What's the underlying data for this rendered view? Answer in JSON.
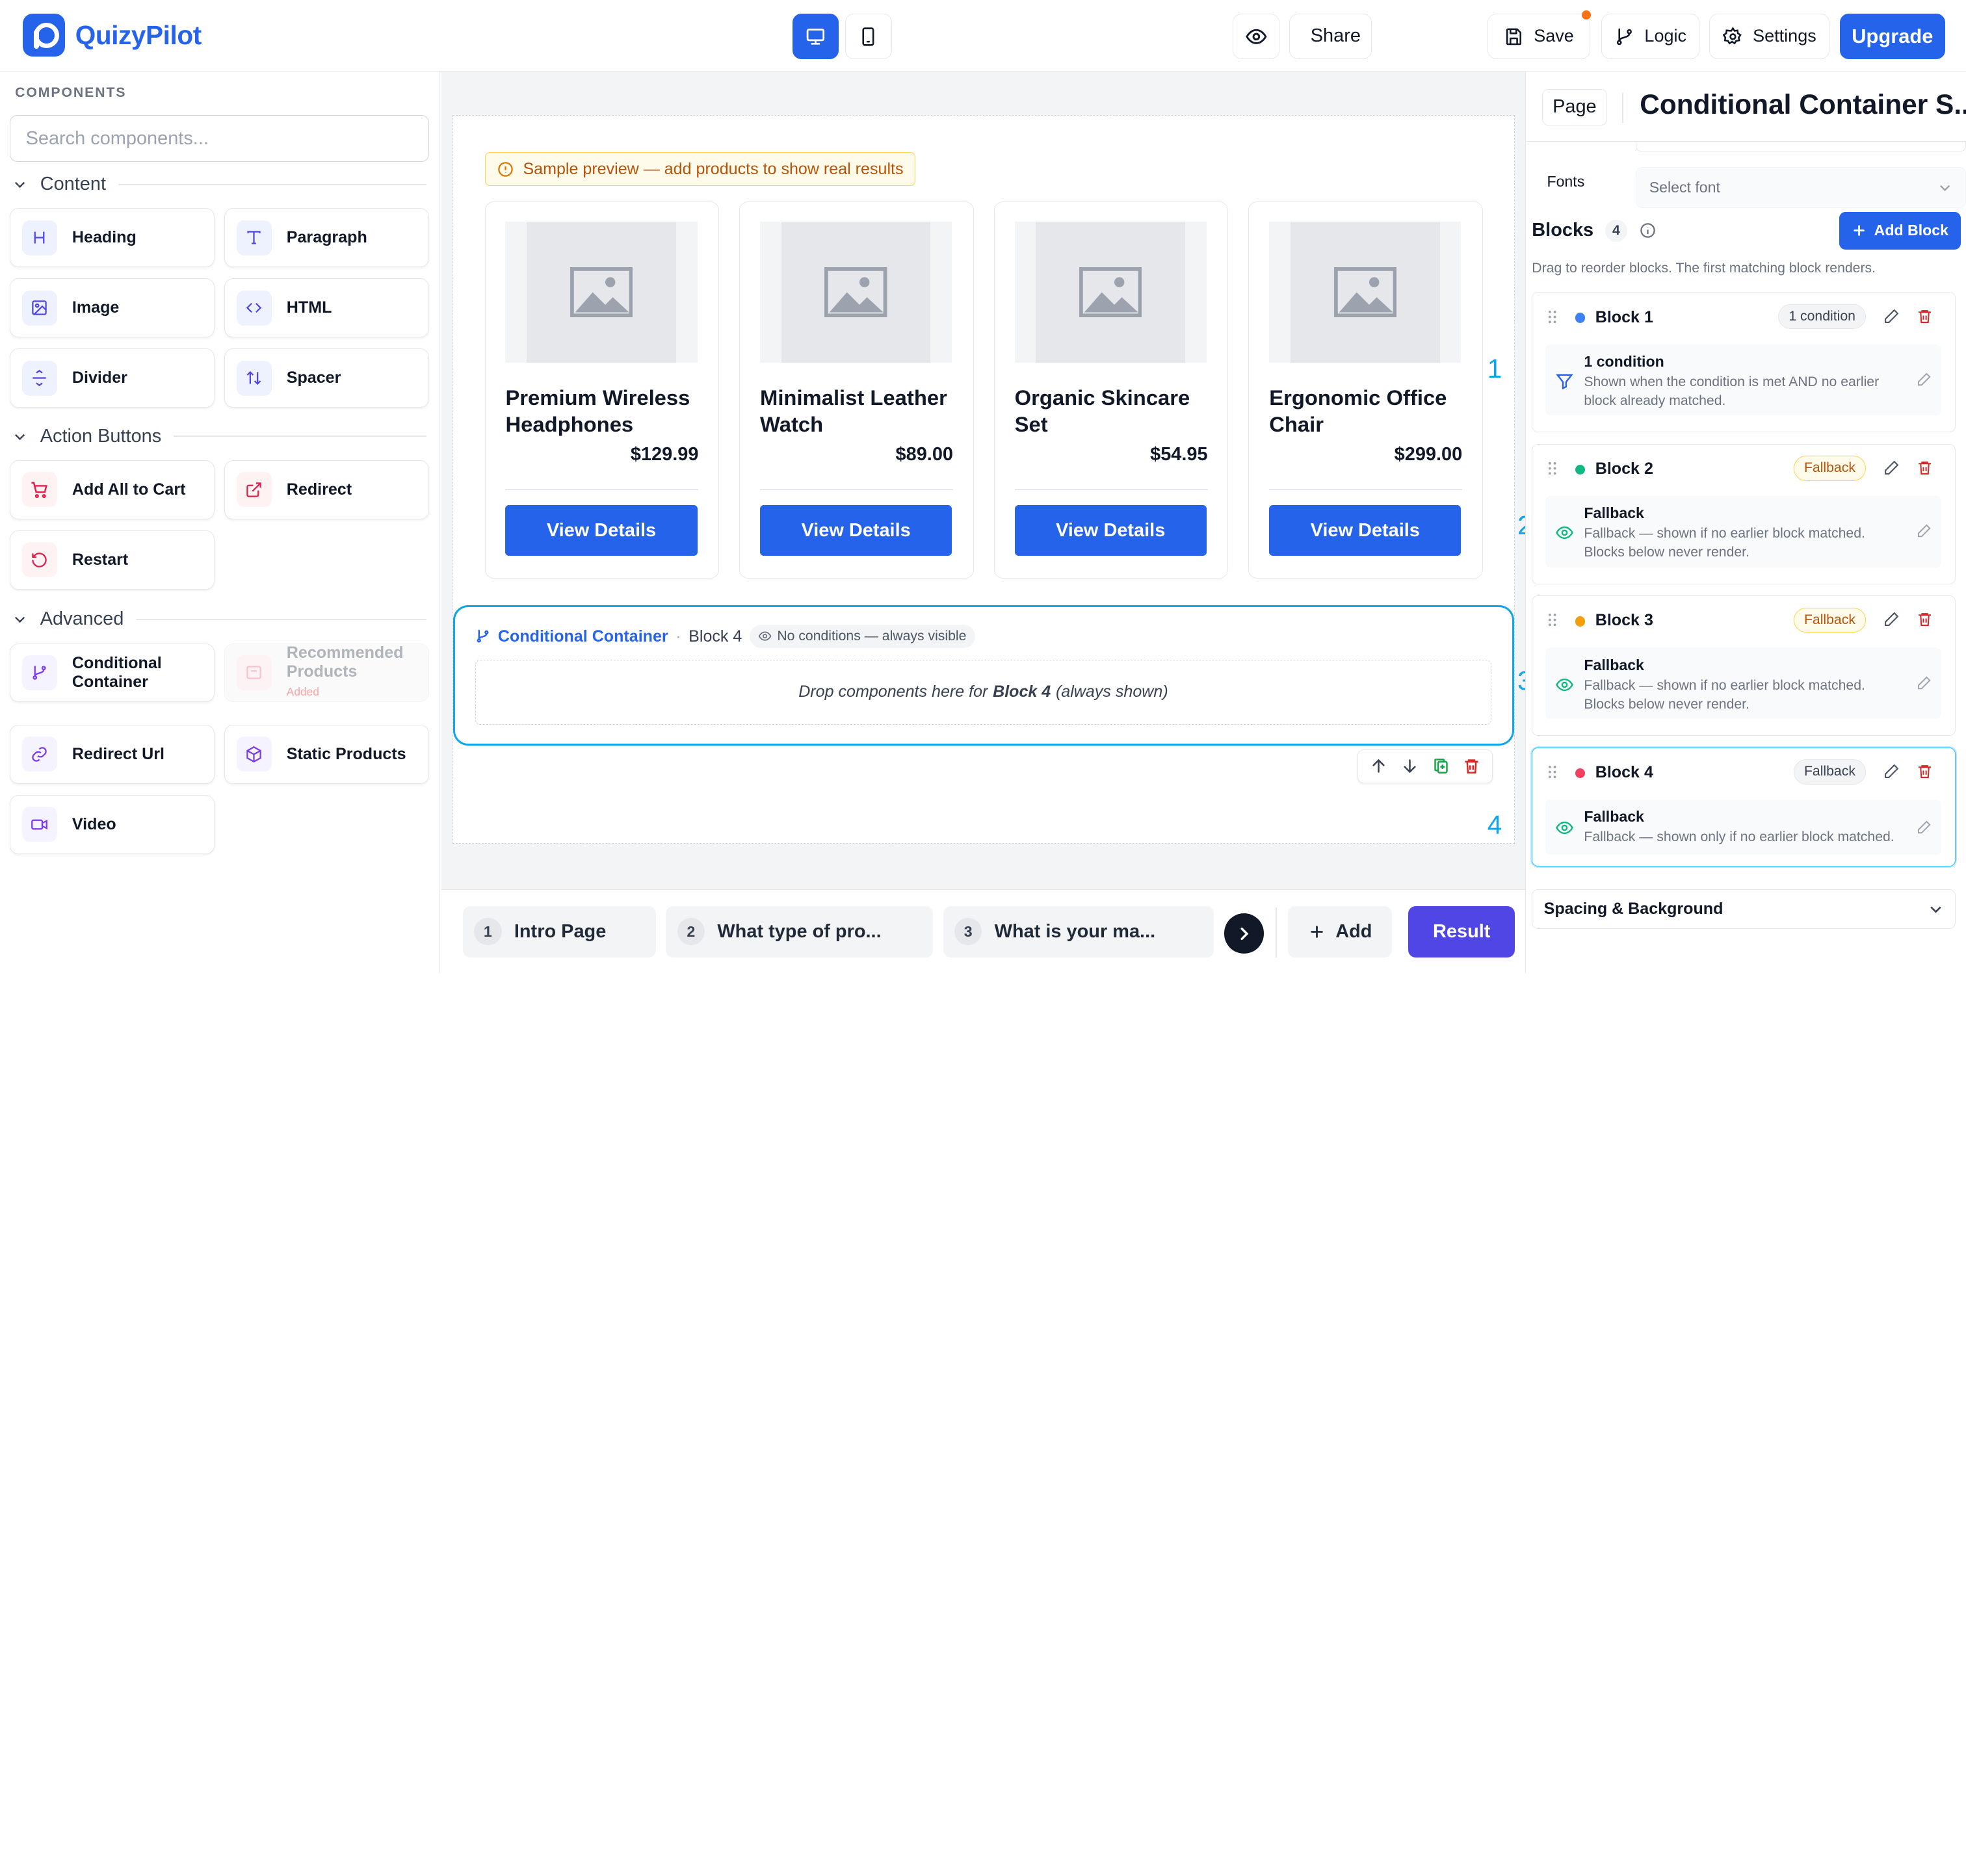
{
  "app": {
    "name": "QuizyPilot"
  },
  "toolbar": {
    "save_label": "Save",
    "logic_label": "Logic",
    "settings_label": "Settings",
    "share_label": "Share",
    "upgrade_label": "Upgrade",
    "view_mode": "desktop"
  },
  "sidebar": {
    "heading": "COMPONENTS",
    "search_placeholder": "Search components...",
    "sections": [
      {
        "title": "Content",
        "items": [
          "Heading",
          "Paragraph",
          "Image",
          "HTML",
          "Divider",
          "Spacer"
        ]
      },
      {
        "title": "Action Buttons",
        "items": [
          "Add All to Cart",
          "Redirect",
          "Restart"
        ]
      },
      {
        "title": "Advanced",
        "items": [
          "Conditional Container",
          "Recommended Products",
          "Redirect Url",
          "Static Products",
          "Video"
        ],
        "recommended_note": "Added"
      }
    ]
  },
  "canvas": {
    "notice": "Sample preview — add products to show real results",
    "products": [
      {
        "name": "Premium Wireless Headphones",
        "price": "$129.99",
        "button": "View Details"
      },
      {
        "name": "Minimalist Leather Watch",
        "price": "$89.00",
        "button": "View Details"
      },
      {
        "name": "Organic Skincare Set",
        "price": "$54.95",
        "button": "View Details"
      },
      {
        "name": "Ergonomic Office Chair",
        "price": "$299.00",
        "button": "View Details"
      }
    ],
    "container": {
      "title": "Conditional Container",
      "separator": "·",
      "block": "Block 4",
      "badge": "No conditions — always visible",
      "drop_prefix": "Drop components here for",
      "drop_block": "Block 4",
      "drop_suffix": "(always shown)"
    },
    "side_numbers": [
      "1",
      "2",
      "3",
      "4"
    ]
  },
  "pages": {
    "tabs": [
      {
        "num": "1",
        "label": "Intro Page"
      },
      {
        "num": "2",
        "label": "What type of pro..."
      },
      {
        "num": "3",
        "label": "What is your ma..."
      }
    ],
    "add_label": "Add",
    "result_label": "Result"
  },
  "panel": {
    "page_chip": "Page",
    "title": "Conditional Container S...",
    "fonts_label": "Fonts",
    "fonts_value": "Select font",
    "blocks_title": "Blocks",
    "blocks_count": "4",
    "add_block_label": "Add Block",
    "hint": "Drag to reorder blocks. The first matching block renders.",
    "blocks": [
      {
        "name": "Block 1",
        "color": "#3b82f6",
        "badge": "1 condition",
        "body_title": "1 condition",
        "body_text": "Shown when the condition is met AND no earlier block already matched."
      },
      {
        "name": "Block 2",
        "color": "#10b981",
        "badge": "Fallback",
        "body_title": "Fallback",
        "body_text": "Fallback — shown if no earlier block matched. Blocks below never render."
      },
      {
        "name": "Block 3",
        "color": "#f59e0b",
        "badge": "Fallback",
        "body_title": "Fallback",
        "body_text": "Fallback — shown if no earlier block matched. Blocks below never render."
      },
      {
        "name": "Block 4",
        "color": "#f43f5e",
        "badge": "Fallback",
        "body_title": "Fallback",
        "body_text": "Fallback — shown only if no earlier block matched."
      }
    ],
    "spacing_label": "Spacing & Background"
  }
}
